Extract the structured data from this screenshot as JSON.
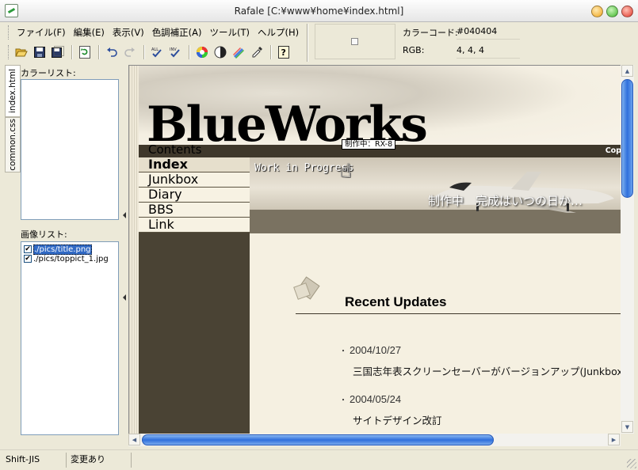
{
  "window": {
    "title": "Rafale [C:¥www¥home¥index.html]"
  },
  "menubar": {
    "items": [
      "ファイル(F)",
      "編集(E)",
      "表示(V)",
      "色調補正(A)",
      "ツール(T)",
      "ヘルプ(H)"
    ]
  },
  "toolbar": {
    "icons": [
      "open-folder-icon",
      "save-icon",
      "save-all-icon",
      "refresh-icon",
      "undo-icon",
      "redo-icon",
      "check-all-icon",
      "invert-check-icon",
      "color-wheel-icon",
      "contrast-icon",
      "palette-icon",
      "eyedropper-icon",
      "help-icon"
    ]
  },
  "color_info": {
    "code_label": "カラーコード:",
    "code_value": "#040404",
    "rgb_label": "RGB:",
    "rgb_value": "4, 4, 4"
  },
  "side_tabs": [
    "index.html",
    "common.css"
  ],
  "left_panel": {
    "color_list_label": "カラーリスト:",
    "image_list_label": "画像リスト:",
    "images": [
      {
        "name": "./pics/title.png",
        "checked": true,
        "selected": true
      },
      {
        "name": "./pics/toppict_1.jpg",
        "checked": true,
        "selected": false
      }
    ]
  },
  "preview": {
    "logo": "BlueWorks",
    "contents_label": "Contents",
    "copyright": "Cop",
    "tooltip": "制作中：RX-8",
    "nav": [
      "Index",
      "Junkbox",
      "Diary",
      "BBS",
      "Link"
    ],
    "hero_caption1": "Work in Progress",
    "hero_caption2": "制作中　完成はいつの日か…",
    "recent_title": "Recent Updates",
    "updates": [
      {
        "date": "2004/10/27",
        "text": "三国志年表スクリーンセーバーがバージョンアップ(Junkbox)"
      },
      {
        "date": "2004/05/24",
        "text": "サイトデザイン改訂"
      }
    ]
  },
  "statusbar": {
    "encoding": "Shift-JIS",
    "modified": "変更あり"
  },
  "colors": {
    "accent": "#316ac5",
    "nav_dark": "#4a4334",
    "content_bg": "#f5f0e1"
  }
}
